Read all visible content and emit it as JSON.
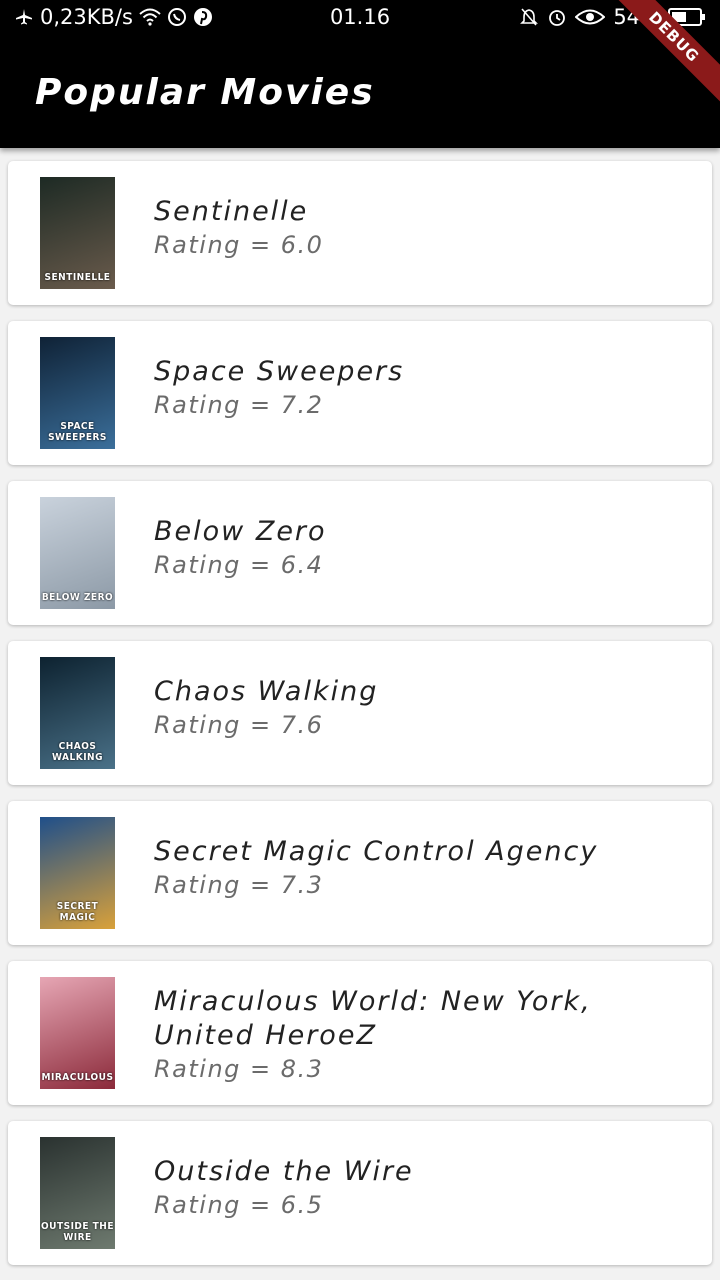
{
  "status_bar": {
    "speed": "0,23KB/s",
    "time": "01.16",
    "battery": "54%",
    "battery_level": 0.54,
    "left_icons": [
      "airplane-icon",
      "wifi-icon",
      "whatsapp-icon",
      "pinterest-icon"
    ],
    "right_icons": [
      "mute-icon",
      "alarm-icon",
      "eye-icon",
      "battery-icon"
    ]
  },
  "app_bar": {
    "title": "Popular Movies",
    "banner": "DEBUG"
  },
  "movies": [
    {
      "title": "Sentinelle",
      "rating": "Rating = 6.0",
      "poster_text": "SENTINELLE",
      "poster_colors": [
        "#1d2a24",
        "#6a5b4c"
      ]
    },
    {
      "title": "Space Sweepers",
      "rating": "Rating = 7.2",
      "poster_text": "SPACE SWEEPERS",
      "poster_colors": [
        "#0f2236",
        "#3b6f9b"
      ]
    },
    {
      "title": "Below Zero",
      "rating": "Rating = 6.4",
      "poster_text": "BELOW ZERO",
      "poster_colors": [
        "#c9d2dc",
        "#8c99a6"
      ]
    },
    {
      "title": "Chaos Walking",
      "rating": "Rating = 7.6",
      "poster_text": "CHAOS WALKING",
      "poster_colors": [
        "#0d2230",
        "#4a7188"
      ]
    },
    {
      "title": "Secret Magic Control Agency",
      "rating": "Rating = 7.3",
      "poster_text": "SECRET MAGIC",
      "poster_colors": [
        "#1f4f8a",
        "#d9a13a"
      ]
    },
    {
      "title": "Miraculous World: New York, United HeroeZ",
      "rating": "Rating = 8.3",
      "poster_text": "MIRACULOUS",
      "poster_colors": [
        "#e6a6b4",
        "#8b2a3a"
      ]
    },
    {
      "title": "Outside the Wire",
      "rating": "Rating = 6.5",
      "poster_text": "OUTSIDE THE WIRE",
      "poster_colors": [
        "#2a3230",
        "#6e7a6f"
      ]
    }
  ]
}
